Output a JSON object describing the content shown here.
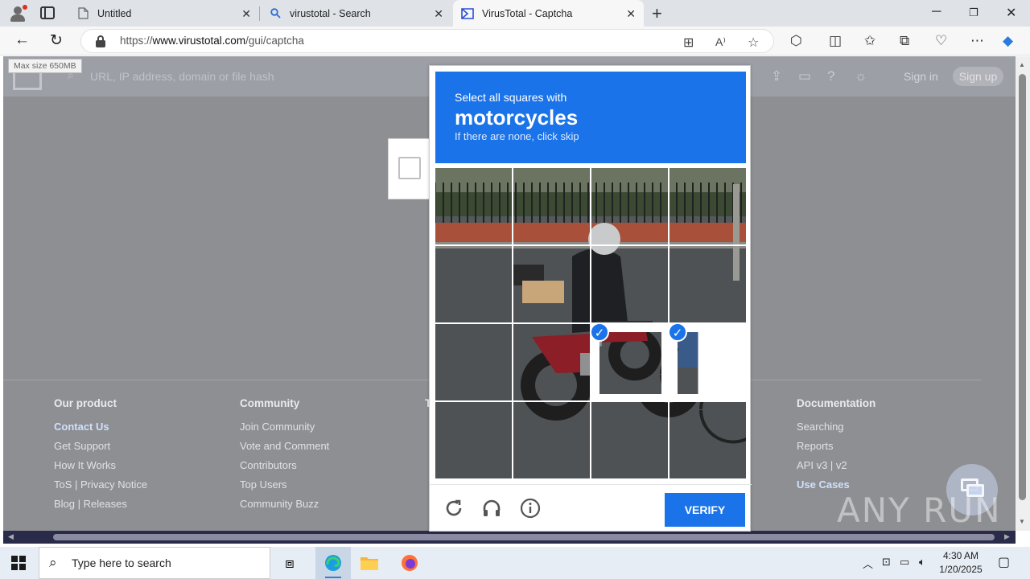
{
  "browser": {
    "tabs": [
      {
        "title": "Untitled",
        "icon": "page-icon"
      },
      {
        "title": "virustotal - Search",
        "icon": "search-icon"
      },
      {
        "title": "VirusTotal - Captcha",
        "icon": "virustotal-icon",
        "active": true
      }
    ],
    "url_prefix": "https://",
    "url_host": "www.virustotal.com",
    "url_path": "/gui/captcha"
  },
  "site": {
    "tooltip": "Max size 650MB",
    "search_placeholder": "URL, IP address, domain or file hash",
    "sign_in": "Sign in",
    "sign_up": "Sign up",
    "footer": {
      "columns": [
        {
          "heading": "Our product",
          "links": [
            "Contact Us",
            "Get Support",
            "How It Works",
            "ToS | Privacy Notice",
            "Blog | Releases"
          ]
        },
        {
          "heading": "Community",
          "links": [
            "Join Community",
            "Vote and Comment",
            "Contributors",
            "Top Users",
            "Community Buzz"
          ]
        },
        {
          "heading": "Documentation",
          "links": [
            "Searching",
            "Reports",
            "API v3 | v2",
            "Use Cases"
          ]
        }
      ],
      "partial_heading": "T"
    },
    "watermark": "ANY RUN"
  },
  "captcha": {
    "instruction": "Select all squares with",
    "target": "motorcycles",
    "hint": "If there are none, click skip",
    "verify_label": "VERIFY",
    "selected_tiles": [
      10,
      11
    ]
  },
  "taskbar": {
    "search_placeholder": "Type here to search",
    "time": "4:30 AM",
    "date": "1/20/2025"
  }
}
